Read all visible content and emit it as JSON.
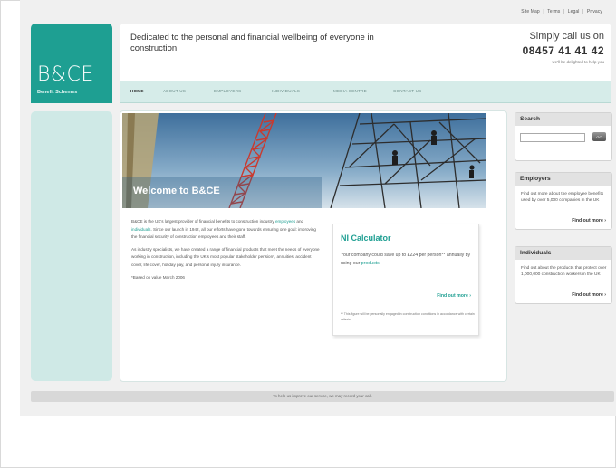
{
  "top_links": [
    "Site Map",
    "Terms",
    "Legal",
    "Privacy"
  ],
  "logo": {
    "mark": "B&CE",
    "sub": "Benefit Schemes"
  },
  "header": {
    "tagline": "Dedicated to the personal and financial wellbeing of everyone in construction",
    "call_line1": "Simply call us on",
    "phone": "08457 41 41 42",
    "call_line3": "we'll be delighted to help you"
  },
  "nav": [
    "HOME",
    "ABOUT US",
    "EMPLOYERS",
    "INDIVIDUALS",
    "MEDIA CENTRE",
    "CONTACT US"
  ],
  "hero": {
    "welcome": "Welcome to B&CE"
  },
  "intro": {
    "p1_a": "B&CE is the UK's largest provider of financial benefits to construction industry ",
    "p1_link1": "employees",
    "p1_and": " and ",
    "p1_link2": "individuals",
    "p1_b": ". Since our launch in 1942, all our efforts have gone towards ensuring one goal: improving the financial security of construction employees and their staff.",
    "p2": "As industry specialists, we have created a range of financial products that meet the needs of everyone working in construction, including the UK's most popular stakeholder pension*, annuities, accident cover, life cover, holiday pay, and personal injury insurance.",
    "p3": "*Based on value March 2006"
  },
  "ni_calculator": {
    "title": "NI Calculator",
    "desc_a": "Your company could save up to £224 per person** annually by using our ",
    "desc_link": "products",
    "desc_b": ".",
    "more": "Find out more ›",
    "footnote": "** This figure will be personally engaged in construction conditions in accordance with certain criteria."
  },
  "search": {
    "title": "Search",
    "placeholder": "",
    "button": "GO"
  },
  "employers": {
    "title": "Employers",
    "desc": "Find out more about the employee benefits used by over 5,000 companies in the UK",
    "more": "Find out more ›"
  },
  "individuals": {
    "title": "Individuals",
    "desc": "Find out about the products that protect over 1,000,000 construction workers in the UK",
    "more": "Find out more ›"
  },
  "footer": {
    "text": "To help us improve our service, we may record your call."
  },
  "colors": {
    "brand_teal": "#1e9f92",
    "nav_bg": "#d6ece9",
    "left_col": "#cfe9e6"
  }
}
